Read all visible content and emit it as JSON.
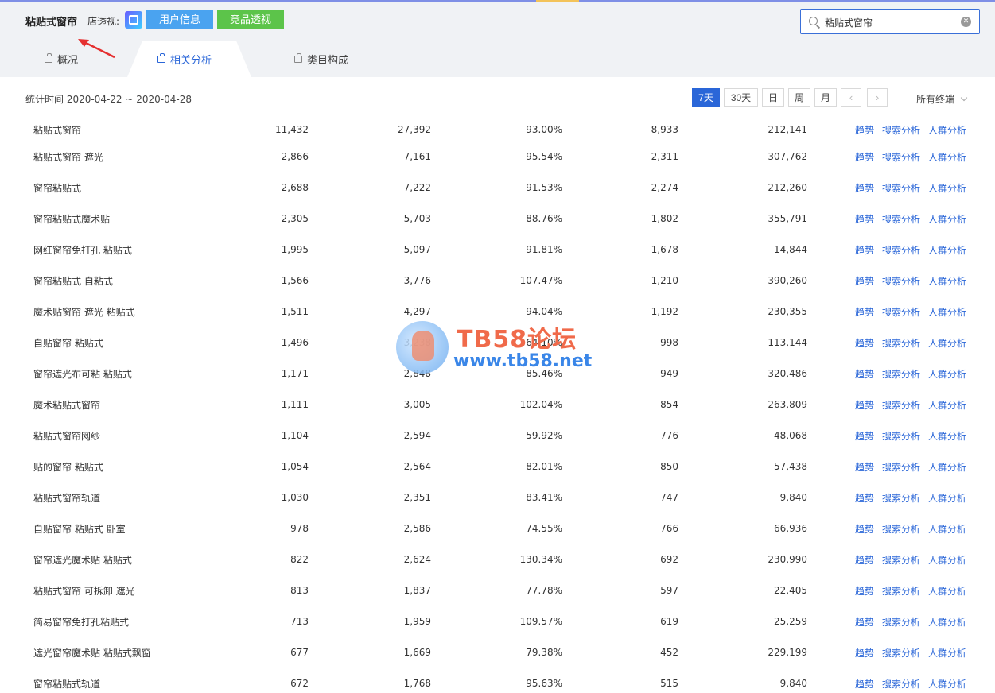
{
  "header": {
    "title": "粘贴式窗帘",
    "shop_label": "店透视:",
    "user_info_btn": "用户信息",
    "competitor_btn": "竞品透视",
    "search_value": "粘贴式窗帘"
  },
  "tabs": [
    {
      "label": "概况"
    },
    {
      "label": "相关分析"
    },
    {
      "label": "类目构成"
    }
  ],
  "filter": {
    "stat_time": "统计时间 2020-04-22 ~ 2020-04-28",
    "periods": [
      "7天",
      "30天",
      "日",
      "周",
      "月"
    ],
    "prev": "‹",
    "next": "›",
    "terminal": "所有终端"
  },
  "ops": [
    "趋势",
    "搜索分析",
    "人群分析"
  ],
  "rows": [
    [
      "粘贴式窗帘",
      "11,432",
      "27,392",
      "93.00%",
      "8,933",
      "212,141"
    ],
    [
      "粘贴式窗帘 遮光",
      "2,866",
      "7,161",
      "95.54%",
      "2,311",
      "307,762"
    ],
    [
      "窗帘粘贴式",
      "2,688",
      "7,222",
      "91.53%",
      "2,274",
      "212,260"
    ],
    [
      "窗帘粘贴式魔术贴",
      "2,305",
      "5,703",
      "88.76%",
      "1,802",
      "355,791"
    ],
    [
      "网红窗帘免打孔 粘贴式",
      "1,995",
      "5,097",
      "91.81%",
      "1,678",
      "14,844"
    ],
    [
      "窗帘粘贴式 自粘式",
      "1,566",
      "3,776",
      "107.47%",
      "1,210",
      "390,260"
    ],
    [
      "魔术贴窗帘 遮光 粘贴式",
      "1,511",
      "4,297",
      "94.04%",
      "1,192",
      "230,355"
    ],
    [
      "自贴窗帘 粘贴式",
      "1,496",
      "3,238",
      "64.10%",
      "998",
      "113,144"
    ],
    [
      "窗帘遮光布可粘 粘贴式",
      "1,171",
      "2,848",
      "85.46%",
      "949",
      "320,486"
    ],
    [
      "魔术粘贴式窗帘",
      "1,111",
      "3,005",
      "102.04%",
      "854",
      "263,809"
    ],
    [
      "粘贴式窗帘网纱",
      "1,104",
      "2,594",
      "59.92%",
      "776",
      "48,068"
    ],
    [
      "贴的窗帘 粘贴式",
      "1,054",
      "2,564",
      "82.01%",
      "850",
      "57,438"
    ],
    [
      "粘贴式窗帘轨道",
      "1,030",
      "2,351",
      "83.41%",
      "747",
      "9,840"
    ],
    [
      "自贴窗帘 粘贴式 卧室",
      "978",
      "2,586",
      "74.55%",
      "766",
      "66,936"
    ],
    [
      "窗帘遮光魔术贴 粘贴式",
      "822",
      "2,624",
      "130.34%",
      "692",
      "230,990"
    ],
    [
      "粘贴式窗帘 可拆卸 遮光",
      "813",
      "1,837",
      "77.78%",
      "597",
      "22,405"
    ],
    [
      "简易窗帘免打孔粘贴式",
      "713",
      "1,959",
      "109.57%",
      "619",
      "25,259"
    ],
    [
      "遮光窗帘魔术贴 粘贴式飘窗",
      "677",
      "1,669",
      "79.38%",
      "452",
      "229,199"
    ],
    [
      "窗帘粘贴式轨道",
      "672",
      "1,768",
      "95.63%",
      "515",
      "9,840"
    ]
  ],
  "watermark": {
    "brand": "TB58论坛",
    "url": "www.tb58.net"
  },
  "colors": {
    "primary": "#2a66d8",
    "user_btn": "#4aa3f0",
    "competitor_btn": "#5cc44a",
    "header_bg": "#f0f2f5"
  }
}
